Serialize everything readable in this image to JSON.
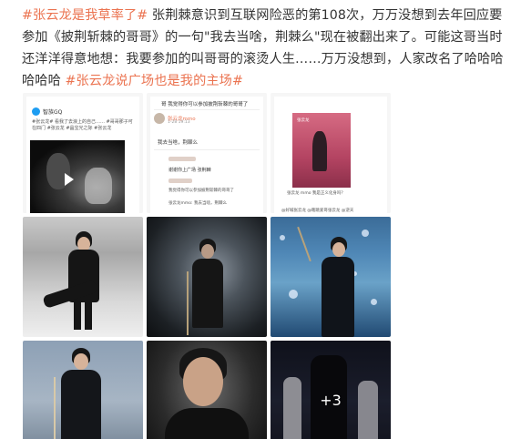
{
  "post": {
    "tag1": "#张云龙是我草率了#",
    "body": "张荆棘意识到互联网险恶的第108次，万万没想到去年回应要参加《披荆斩棘的哥哥》的一句\"我去当啥，荆棘么\"现在被翻出来了。可能这哥当时还洋洋得意地想：我要参加的叫哥哥的滚烫人生……万万没想到，人家改名了哈哈哈哈哈哈",
    "tag2": "#张云龙说广场也是我的主场#"
  },
  "images": {
    "qq": {
      "app_name": "智族GQ",
      "text": "#张云龙# 看我了去浪上的自己…… #哥哥那子可在四门 #张云龙 #晶宝光之际 #张云龙",
      "icon": "play-icon"
    },
    "comment": {
      "header": "哥 我觉得你可以参加披荆斩棘的哥哥了",
      "username": "张云龙mmo",
      "date": "1-28 19:13",
      "reply": "我去当啥，荆棘么",
      "quote_line": "谢谢你上广场 张荆棘",
      "quote_detail": "我觉得你可以参加披荆斩棘的哥哥了",
      "sub_line": "张云龙mmo: 我去当啥，荆棘么"
    },
    "poster": {
      "small_text": "张云龙",
      "caption": "张云龙 mmo 我是正义化身吗？",
      "footer": "@好喊张云龙 @瞎跳爱哥张云龙 @逆天"
    },
    "more_count": "+3"
  },
  "colors": {
    "link": "#eb7350",
    "text": "#333333"
  }
}
